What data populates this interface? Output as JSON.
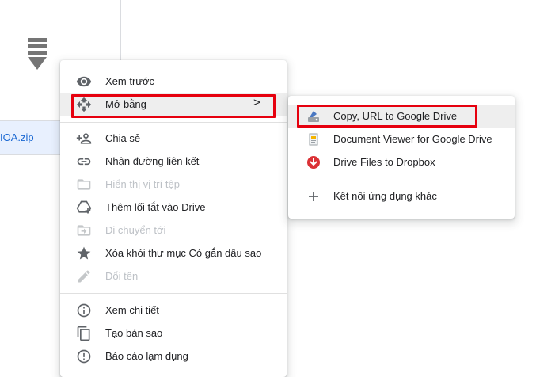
{
  "background": {
    "file_name": "IOA.zip"
  },
  "context_menu": {
    "items": [
      {
        "label": "Xem trước",
        "icon": "eye-icon",
        "disabled": false
      },
      {
        "label": "Mở bằng",
        "icon": "move-arrows-icon",
        "disabled": false,
        "has_submenu": true
      },
      {
        "label": "Chia sẻ",
        "icon": "person-add-icon",
        "disabled": false
      },
      {
        "label": "Nhận đường liên kết",
        "icon": "link-icon",
        "disabled": false
      },
      {
        "label": "Hiển thị vị trí tệp",
        "icon": "folder-icon",
        "disabled": true
      },
      {
        "label": "Thêm lối tắt vào Drive",
        "icon": "add-shortcut-drive-icon",
        "disabled": false
      },
      {
        "label": "Di chuyển tới",
        "icon": "move-to-folder-icon",
        "disabled": true
      },
      {
        "label": "Xóa khỏi thư mục Có gắn dấu sao",
        "icon": "star-icon",
        "disabled": false
      },
      {
        "label": "Đổi tên",
        "icon": "pencil-icon",
        "disabled": true
      },
      {
        "label": "Xem chi tiết",
        "icon": "info-icon",
        "disabled": false
      },
      {
        "label": "Tạo bản sao",
        "icon": "copy-icon",
        "disabled": false
      },
      {
        "label": "Báo cáo lạm dụng",
        "icon": "report-icon",
        "disabled": false
      }
    ],
    "submenu_chevron": ">"
  },
  "open_with_submenu": {
    "items": [
      {
        "label": "Copy, URL to Google Drive",
        "icon": "cloud-upload-app-icon"
      },
      {
        "label": "Document Viewer for Google Drive",
        "icon": "document-viewer-app-icon"
      },
      {
        "label": "Drive Files to Dropbox",
        "icon": "dropbox-app-icon"
      },
      {
        "label": "Kết nối ứng dụng khác",
        "icon": "plus-icon"
      }
    ]
  },
  "colors": {
    "highlight_border": "#e6000e",
    "hover_bg": "#eeeeee",
    "icon_gray": "#5f6368",
    "disabled_text": "#bdc1c6"
  }
}
